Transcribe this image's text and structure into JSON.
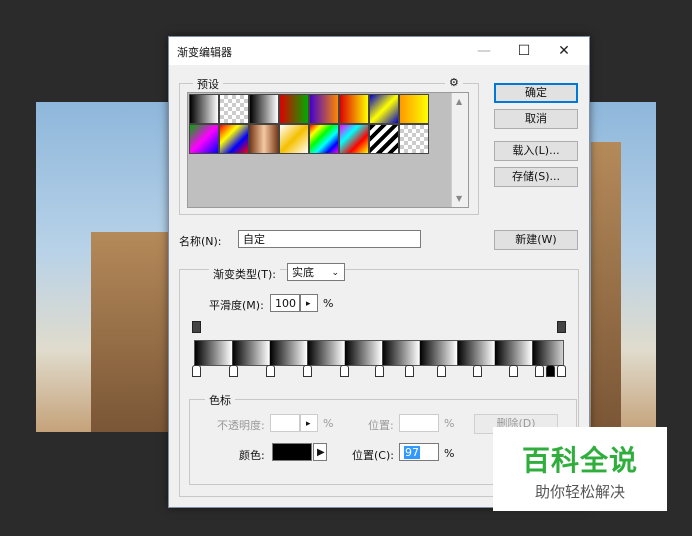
{
  "window": {
    "title": "渐变编辑器",
    "min_icon": "—",
    "max_icon": "☐",
    "close_icon": "✕"
  },
  "presets": {
    "label": "预设",
    "gear_icon": "⚙",
    "scroll_up": "▲",
    "scroll_down": "▼"
  },
  "buttons": {
    "ok": "确定",
    "cancel": "取消",
    "load": "载入(L)...",
    "save": "存储(S)...",
    "new": "新建(W)"
  },
  "name": {
    "label": "名称(N):",
    "value": "自定"
  },
  "gradient_type": {
    "label": "渐变类型(T):",
    "value": "实底"
  },
  "smoothness": {
    "label": "平滑度(M):",
    "value": "100",
    "unit": "%"
  },
  "color_stops": {
    "group_label": "色标",
    "opacity_label": "不透明度:",
    "opacity_unit": "%",
    "opacity_location_label": "位置:",
    "opacity_location_unit": "%",
    "delete": "删除(D)",
    "color_label": "颜色:",
    "color_value": "#000000",
    "location_label": "位置(C):",
    "location_value": "97",
    "location_unit": "%"
  },
  "watermark": {
    "title": "百科全说",
    "subtitle": "助你轻松解决"
  }
}
